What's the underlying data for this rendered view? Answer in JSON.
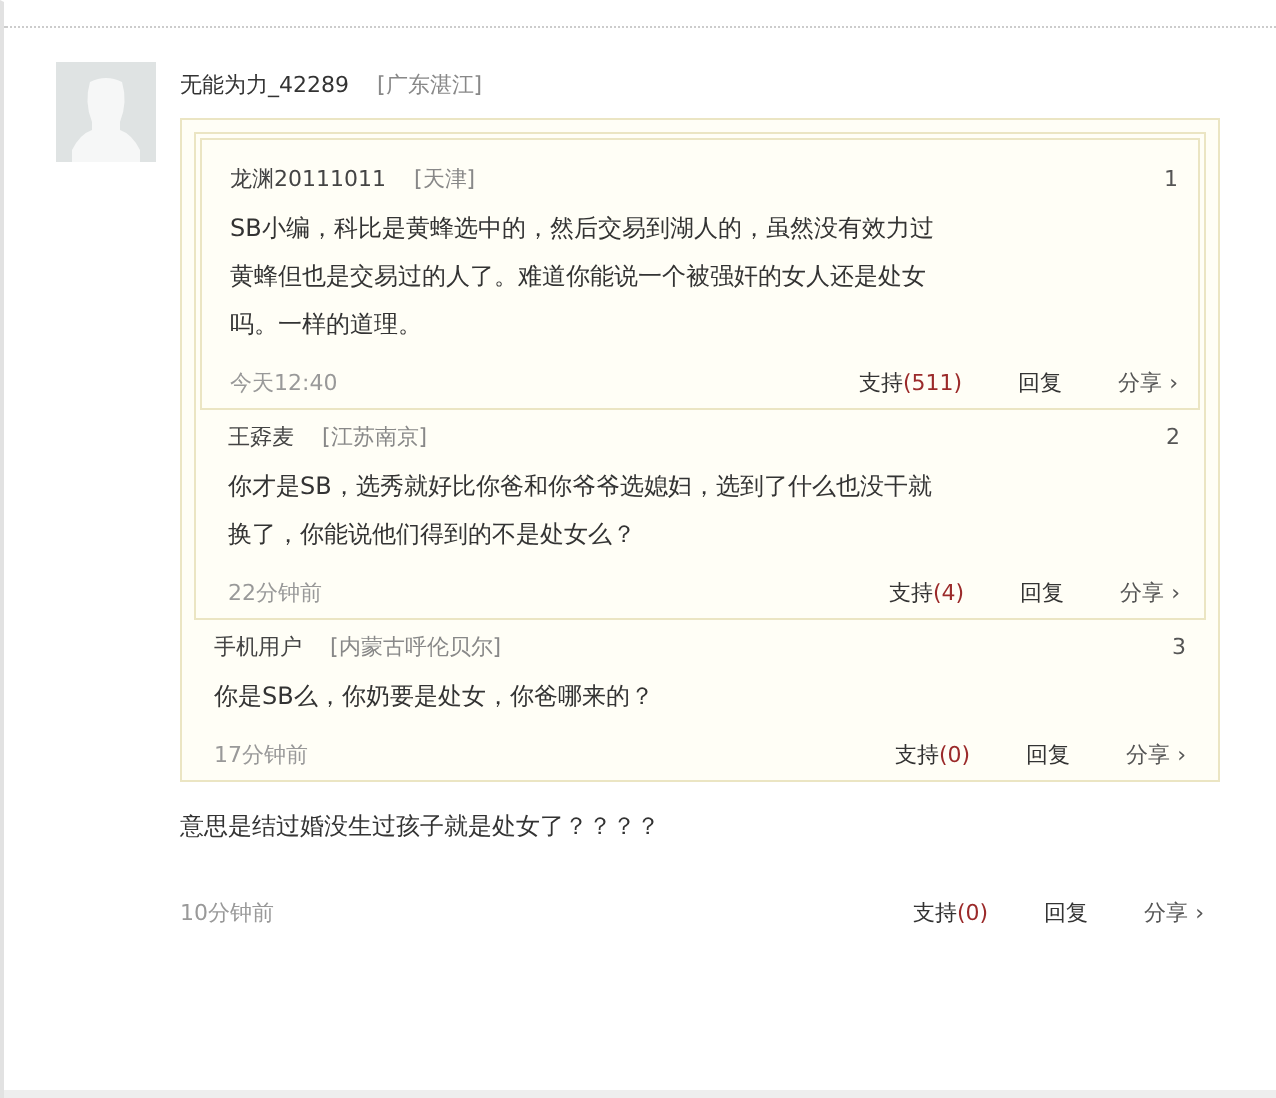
{
  "comment": {
    "author": "无能为力_42289",
    "location": "[广东湛江]",
    "quote": {
      "author": "手机用户",
      "location": "[内蒙古呼伦贝尔]",
      "floor": "3",
      "text": "你是SB么，你奶要是处女，你爸哪来的？",
      "time": "17分钟前",
      "support": "支持",
      "support_count": "(0)",
      "reply": "回复",
      "share": "分享 ›",
      "quote": {
        "author": "王孬麦",
        "location": "[江苏南京]",
        "floor": "2",
        "text": "你才是SB，选秀就好比你爸和你爷爷选媳妇，选到了什么也没干就换了，你能说他们得到的不是处女么？",
        "time": "22分钟前",
        "support": "支持",
        "support_count": "(4)",
        "reply": "回复",
        "share": "分享 ›",
        "quote": {
          "author": "龙渊20111011",
          "location": "[天津]",
          "floor": "1",
          "text": "SB小编，科比是黄蜂选中的，然后交易到湖人的，虽然没有效力过黄蜂但也是交易过的人了。难道你能说一个被强奸的女人还是处女吗。一样的道理。",
          "time": "今天12:40",
          "support": "支持",
          "support_count": "(511)",
          "reply": "回复",
          "share": "分享 ›"
        }
      }
    },
    "text": "意思是结过婚没生过孩子就是处女了？？？？",
    "time": "10分钟前",
    "support": "支持",
    "support_count": "(0)",
    "reply": "回复",
    "share": "分享 ›"
  }
}
